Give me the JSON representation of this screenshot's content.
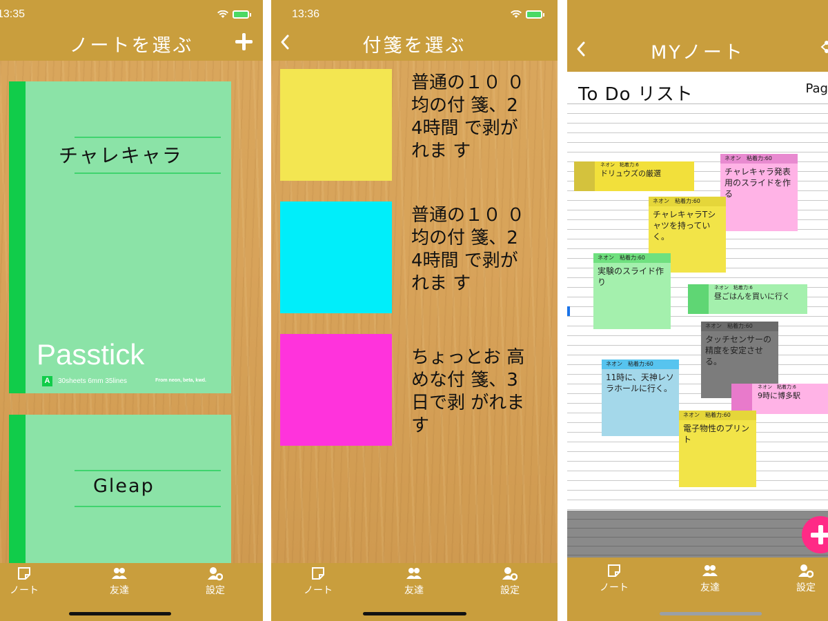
{
  "status_bar": {
    "time_1": "13:35",
    "time_2": "13:36"
  },
  "screen1": {
    "title": "ノートを選ぶ",
    "notes": [
      {
        "title": "チャレキャラ",
        "brand": "Passtick",
        "grade": "A",
        "spec": "30sheets 6mm 35lines",
        "tagline": "From neon, beta, kwd."
      },
      {
        "title": "Gleap"
      }
    ]
  },
  "screen2": {
    "title": "付箋を選ぶ",
    "items": [
      {
        "color": "#f3e651",
        "description": "普通の１０ ０均の付 箋、24時間 で剥がれま す"
      },
      {
        "color": "#00eefa",
        "description": "普通の１０ ０均の付 箋、24時間 で剥がれま す"
      },
      {
        "color": "#ff33dc",
        "description": "ちょっとお 高めな付 箋、3日で剥 がれます"
      }
    ]
  },
  "screen3": {
    "title": "MYノート",
    "paper_title": "To Do リスト",
    "page_label": "Pag",
    "stickies": [
      {
        "head": "ネオン　粘着力:6",
        "text": "ドリュウズの厳選",
        "bg": "#f2e03b",
        "head_bg": "#f2e03b",
        "chip": "#d4c23d"
      },
      {
        "head": "ネオン　粘着力:60",
        "text": "チャレキャラ発表用のスライドを作る",
        "bg": "#ffb3e6",
        "head_bg": "#e88ad0"
      },
      {
        "head": "ネオン　粘着力:60",
        "text": "チャレキャラTシャツを持っていく。",
        "bg": "#f2e448",
        "head_bg": "#e5d63a"
      },
      {
        "head": "ネオン　粘着力:60",
        "text": "実験のスライド作り",
        "bg": "#a4f0ad",
        "head_bg": "#6fe07f"
      },
      {
        "head": "ネオン　粘着力:6",
        "text": "昼ごはんを買いに行く",
        "bg": "#a4f0ad",
        "head_bg": "#a4f0ad",
        "chip": "#5fd674"
      },
      {
        "head": "ネオン　粘着力:60",
        "text": "タッチセンサーの精度を安定させる。",
        "bg": "#7c7c7c",
        "head_bg": "#6a6a6a"
      },
      {
        "head": "ネオン　粘着力:60",
        "text": "11時に、天神レソラホールに行く。",
        "bg": "#a4d8ea",
        "head_bg": "#57c4ef"
      },
      {
        "head": "ネオン　粘着力:6",
        "text": "9時に博多駅",
        "bg": "#ffb3e6",
        "head_bg": "#ffb3e6",
        "chip": "#e87acb"
      },
      {
        "head": "ネオン　粘着力:60",
        "text": "電子物性のプリント",
        "bg": "#f2e448",
        "head_bg": "#e5d63a"
      }
    ]
  },
  "tabs": {
    "note": "ノート",
    "friends": "友達",
    "settings": "設定"
  },
  "colors": {
    "header": "#c99e3d",
    "note_green": "#8be3a7",
    "spine_green": "#11cc4a",
    "fab_pink": "#ff2a86"
  }
}
